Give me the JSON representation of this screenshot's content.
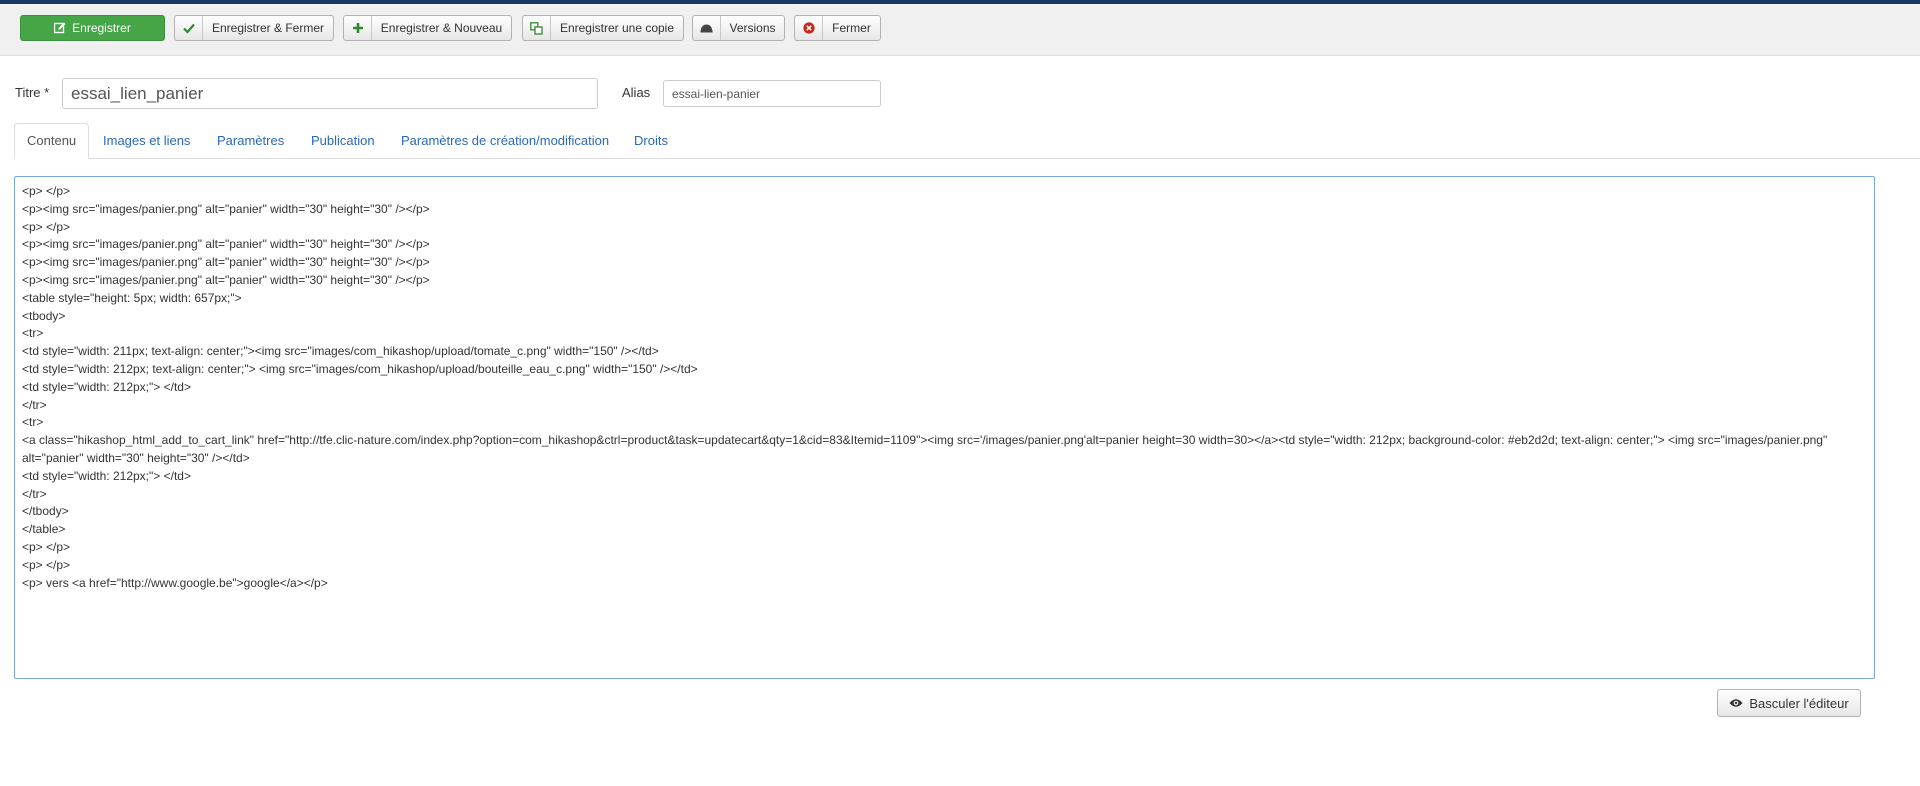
{
  "toolbar": {
    "save": "Enregistrer",
    "save_close": "Enregistrer & Fermer",
    "save_new": "Enregistrer & Nouveau",
    "save_copy": "Enregistrer une copie",
    "versions": "Versions",
    "close": "Fermer"
  },
  "form": {
    "title_label": "Titre *",
    "title_value": "essai_lien_panier",
    "alias_label": "Alias",
    "alias_value": "essai-lien-panier"
  },
  "tabs": [
    {
      "label": "Contenu",
      "active": true
    },
    {
      "label": "Images et liens",
      "active": false
    },
    {
      "label": "Paramètres",
      "active": false
    },
    {
      "label": "Publication",
      "active": false
    },
    {
      "label": "Paramètres de création/modification",
      "active": false
    },
    {
      "label": "Droits",
      "active": false
    }
  ],
  "editor": {
    "lines": [
      "<p> </p>",
      "<p><img src=\"images/panier.png\" alt=\"panier\" width=\"30\" height=\"30\" /></p>",
      "<p> </p>",
      "<p><img src=\"images/panier.png\" alt=\"panier\" width=\"30\" height=\"30\" /></p>",
      "<p><img src=\"images/panier.png\" alt=\"panier\" width=\"30\" height=\"30\" /></p>",
      "<p><img src=\"images/panier.png\" alt=\"panier\" width=\"30\" height=\"30\" /></p>",
      "<table style=\"height: 5px; width: 657px;\">",
      "<tbody>",
      "<tr>",
      "<td style=\"width: 211px; text-align: center;\"><img src=\"images/com_hikashop/upload/tomate_c.png\" width=\"150\" /></td>",
      "<td style=\"width: 212px; text-align: center;\"> <img src=\"images/com_hikashop/upload/bouteille_eau_c.png\" width=\"150\" /></td>",
      "<td style=\"width: 212px;\"> </td>",
      "</tr>",
      "<tr>",
      "<a class=\"hikashop_html_add_to_cart_link\" href=\"http://tfe.clic-nature.com/index.php?option=com_hikashop&ctrl=product&task=updatecart&qty=1&cid=83&Itemid=1109\"><img src='/images/panier.png'alt=panier height=30 width=30></a><td style=\"width: 212px; background-color: #eb2d2d; text-align: center;\"> <img src=\"images/panier.png\" alt=\"panier\" width=\"30\" height=\"30\" /></td>",
      "<td style=\"width: 212px;\"> </td>",
      "</tr>",
      "</tbody>",
      "</table>",
      "<p> </p>",
      "<p> </p>",
      "<p> vers <a href=\"http://www.google.be\">google</a></p>"
    ]
  },
  "toggle_editor": "Basculer l'éditeur",
  "colors": {
    "primary_green": "#46a546",
    "link_blue": "#2a69b8",
    "top_bar": "#1a3867"
  }
}
